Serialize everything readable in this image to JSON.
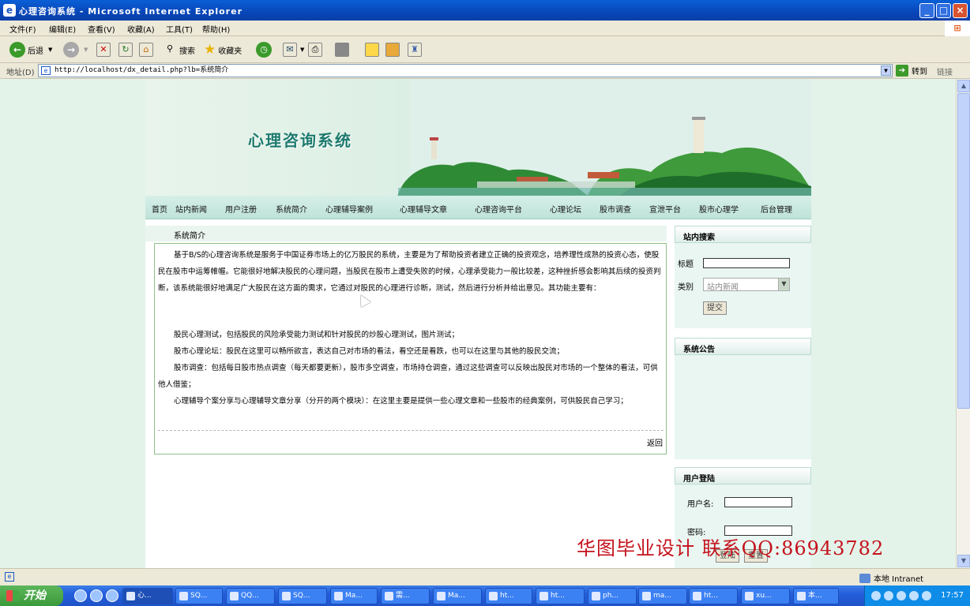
{
  "window": {
    "title": "心理咨询系统 - Microsoft Internet Explorer",
    "min": "_",
    "max": "□",
    "close": "×"
  },
  "menu": [
    "文件(F)",
    "编辑(E)",
    "查看(V)",
    "收藏(A)",
    "工具(T)",
    "帮助(H)"
  ],
  "toolbar": {
    "back": "后退",
    "search": "搜索",
    "favorites": "收藏夹"
  },
  "address": {
    "label": "地址(D)",
    "url": "http://localhost/dx_detail.php?lb=系统简介",
    "go": "转到",
    "links": "链接"
  },
  "site": {
    "title": "心理咨询系统",
    "nav": [
      "首页",
      "站内新闻",
      "用户注册",
      "系统简介",
      "心理辅导案例",
      "心理辅导文章",
      "心理咨询平台",
      "心理论坛",
      "股市调查",
      "宣泄平台",
      "股市心理学",
      "后台管理"
    ],
    "breadcrumb": "系统简介",
    "article": {
      "intro": "基于B/S的心理咨询系统是服务于中国证券市场上的亿万股民的系统，主要是为了帮助投资者建立正确的投资观念，培养理性成熟的投资心态，使股民在股市中运筹帷幄。它能很好地解决股民的心理问题，当股民在股市上遭受失败的时候，心理承受能力一般比较差，这种挫折感会影响其后续的投资判断，该系统能很好地满足广大股民在这方面的需求，它通过对股民的心理进行诊断，测试，然后进行分析并给出意见。其功能主要有：",
      "item1": "股民心理测试，包括股民的风险承受能力测试和针对股民的炒股心理测试，图片测试；",
      "item2": "股市心理论坛：股民在这里可以畅所欲言，表达自己对市场的看法，看空还是看跌，也可以在这里与其他的股民交流；",
      "item3": "股市调查：包括每日股市热点调查（每天都要更新），股市多空调查，市场持仓调查，通过这些调查可以反映出股民对市场的一个整体的看法，可供他人借鉴；",
      "item4": "心理辅导个案分享与心理辅导文章分享（分开的两个模块）：在这里主要是提供一些心理文章和一些股市的经典案例，可供股民自己学习；",
      "back": "返回"
    },
    "sidebar": {
      "search_title": "站内搜索",
      "title_label": "标题",
      "category_label": "类别",
      "category_value": "站内新闻",
      "submit": "提交",
      "notice_title": "系统公告",
      "login_title": "用户登陆",
      "username_label": "用户名:",
      "password_label": "密码:",
      "login_btn": "登陆",
      "reset_btn": "重置"
    }
  },
  "watermark": "华图毕业设计 联系QQ:86943782",
  "status": {
    "zone": "本地 Intranet"
  },
  "taskbar": {
    "start": "开始",
    "items": [
      "心...",
      "SQ...",
      "QQ...",
      "SQ...",
      "Ma...",
      "需...",
      "Ma...",
      "ht...",
      "ht...",
      "ph...",
      "ma...",
      "ht...",
      "xu...",
      "本..."
    ],
    "clock": "17:57"
  }
}
